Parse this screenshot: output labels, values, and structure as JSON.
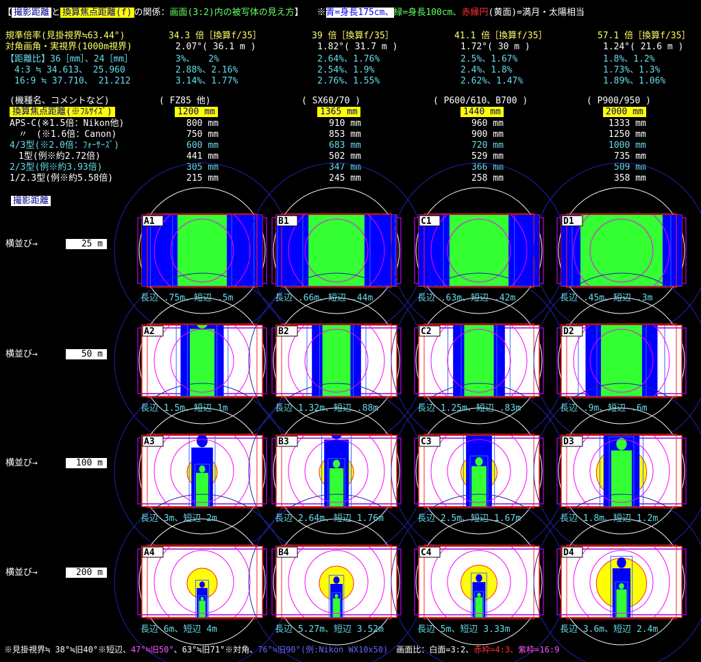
{
  "title": {
    "bracket_open": "【",
    "label1": "撮影距離",
    "and": "と",
    "label2": "換算焦点距離(f)",
    "rel": "の関係：",
    "screen": "画面(3:2)内の被写体の見え方",
    "close": "】",
    "note_prefix": "※",
    "blue": "青=身長175cm、",
    "green": "緑=身長100cm、",
    "red": "赤縁円",
    "yellow": "(黄面)=満月・太陽相当"
  },
  "left_labels": {
    "row1": "規準倍率(見掛視界≒63.44°)",
    "row2": "対角画角・実視界(1000m視界)",
    "row3": "【距離比】36［mm］、24［mm］",
    "row4": "　4:3 ≒ 34.613、 25.960",
    "row5": "　16:9 ≒ 37.710、 21.212"
  },
  "columns": [
    {
      "mag": "34.3 倍［換算f/35］",
      "fov": "2.07°( 36.1 m )",
      "r32": "3%、　　2%",
      "r43": "2.88%、2.16%",
      "r169": "3.14%、1.77%",
      "model": "( FZ85 他)",
      "f_full": "1200 mm",
      "f_apsc_n": "800 mm",
      "f_apsc_c": "750 mm",
      "f_43": "600 mm",
      "f_1": "441 mm",
      "f_23": "305 mm",
      "f_123": "215 mm"
    },
    {
      "mag": "39 倍［換算f/35］",
      "fov": "1.82°( 31.7 m )",
      "r32": "2.64%、1.76%",
      "r43": "2.54%、1.9%",
      "r169": "2.76%、1.55%",
      "model": "( SX60/70 )",
      "f_full": "1365 mm",
      "f_apsc_n": "910 mm",
      "f_apsc_c": "853 mm",
      "f_43": "683 mm",
      "f_1": "502 mm",
      "f_23": "347 mm",
      "f_123": "245 mm"
    },
    {
      "mag": "41.1 倍［換算f/35］",
      "fov": "1.72°( 30 m )",
      "r32": "2.5%、1.67%",
      "r43": "2.4%、1.8%",
      "r169": "2.62%、1.47%",
      "model": "( P600/610、B700 )",
      "f_full": "1440 mm",
      "f_apsc_n": "960 mm",
      "f_apsc_c": "900 mm",
      "f_43": "720 mm",
      "f_1": "529 mm",
      "f_23": "366 mm",
      "f_123": "258 mm"
    },
    {
      "mag": "57.1 倍［換算f/35］",
      "fov": "1.24°( 21.6 m )",
      "r32": "1.8%、1.2%",
      "r43": "1.73%、1.3%",
      "r169": "1.89%、1.06%",
      "model": "( P900/950 )",
      "f_full": "2000 mm",
      "f_apsc_n": "1333 mm",
      "f_apsc_c": "1250 mm",
      "f_43": "1000 mm",
      "f_1": "735 mm",
      "f_23": "509 mm",
      "f_123": "358 mm"
    }
  ],
  "spec_labels": {
    "model": "(機種名、コメントなど)",
    "f_full": "換算焦点距離(※ﾌﾙｻｲｽﾞ)",
    "f_apsc_n": "APS-C(※1.5倍：Nikon他)",
    "f_apsc_c": "　〃　(※1.6倍：Canon)",
    "f_43": "4/3型(※2.0倍：ﾌｫｰｻｰｽﾞ)",
    "f_1": "　1型(例※約2.72倍)",
    "f_23": "2/3型(例※約3.93倍)",
    "f_123": "1/2.3型(例※約5.58倍)"
  },
  "distance_title": "撮影距離",
  "row_label": "横並び→",
  "distances": [
    "25 m",
    "50 m",
    "100 m",
    "200 m"
  ],
  "panel_ids": [
    [
      "A1",
      "B1",
      "C1",
      "D1"
    ],
    [
      "A2",
      "B2",
      "C2",
      "D2"
    ],
    [
      "A3",
      "B3",
      "C3",
      "D3"
    ],
    [
      "A4",
      "B4",
      "C4",
      "D4"
    ]
  ],
  "captions": [
    [
      "長辺 .75m、短辺 .5m",
      "長辺 .66m、短辺 .44m",
      "長辺 .63m、短辺 .42m",
      "長辺 .45m、短辺 .3m"
    ],
    [
      "長辺 1.5m、短辺 1m",
      "長辺 1.32m、短辺 .88m",
      "長辺 1.25m、短辺 .83m",
      "長辺 .9m、短辺 .6m"
    ],
    [
      "長辺 3m、短辺 2m",
      "長辺 2.64m、短辺 1.76m",
      "長辺 2.5m、短辺 1.67m",
      "長辺 1.8m、短辺 1.2m"
    ],
    [
      "長辺 6m、短辺 4m",
      "長辺 5.27m、短辺 3.52m",
      "長辺 5m、短辺 3.33m",
      "長辺 3.6m、短辺 2.4m"
    ]
  ],
  "footer": {
    "a": "※見掛視界≒ 38°≒旧40°※短辺、",
    "b": "47°≒旧50°",
    "c": "、63°≒旧71°※対角、",
    "d": "76°≒旧90°(例:Nikon WX10x50)",
    "e": "　画面比：白面=3:2、",
    "f": "赤枠=4:3、",
    "g": "紫枠=16:9"
  },
  "colors": {
    "blue": "#0000ff",
    "green": "#33ff33",
    "yellow": "#ffff00",
    "red": "#ff2222",
    "purple": "#9900cc",
    "navy_ring": "#2222aa"
  }
}
